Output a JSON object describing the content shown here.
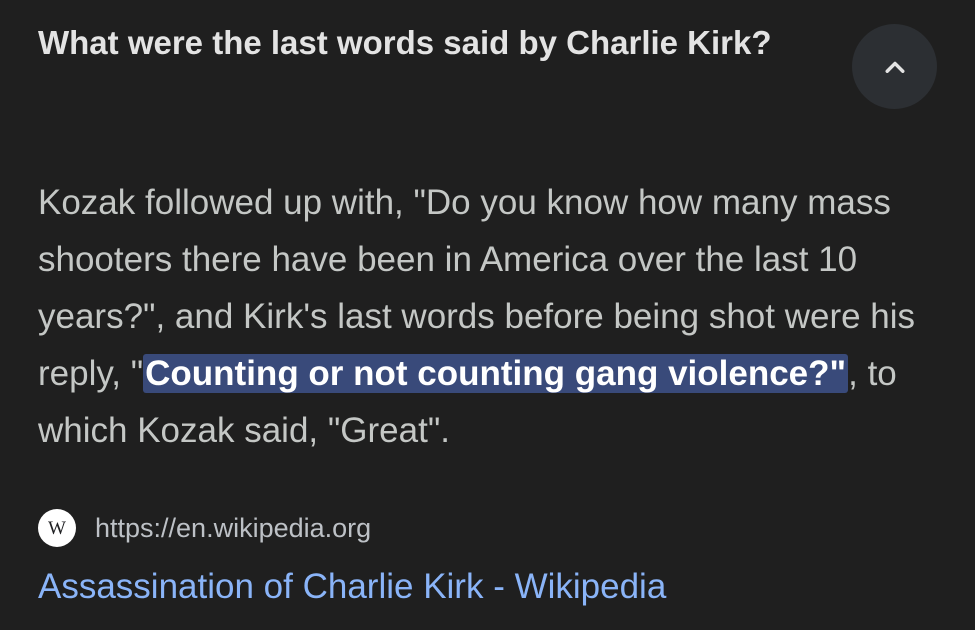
{
  "question": {
    "title": "What were the last words said by Charlie Kirk?",
    "collapse_icon": "chevron-up-icon"
  },
  "answer": {
    "text_before": "Kozak followed up with, \"Do you know how many mass shooters there have been in America over the last 10 years?\", and Kirk's last words before being shot were his reply, \"",
    "highlighted": "Counting or not counting gang violence?\"",
    "text_after": ", to which Kozak said, \"Great\".",
    "highlight_color": "#394a7a"
  },
  "source": {
    "favicon_letter": "W",
    "url": "https://en.wikipedia.org",
    "title": "Assassination of Charlie Kirk - Wikipedia",
    "link_color": "#8ab4f8"
  }
}
